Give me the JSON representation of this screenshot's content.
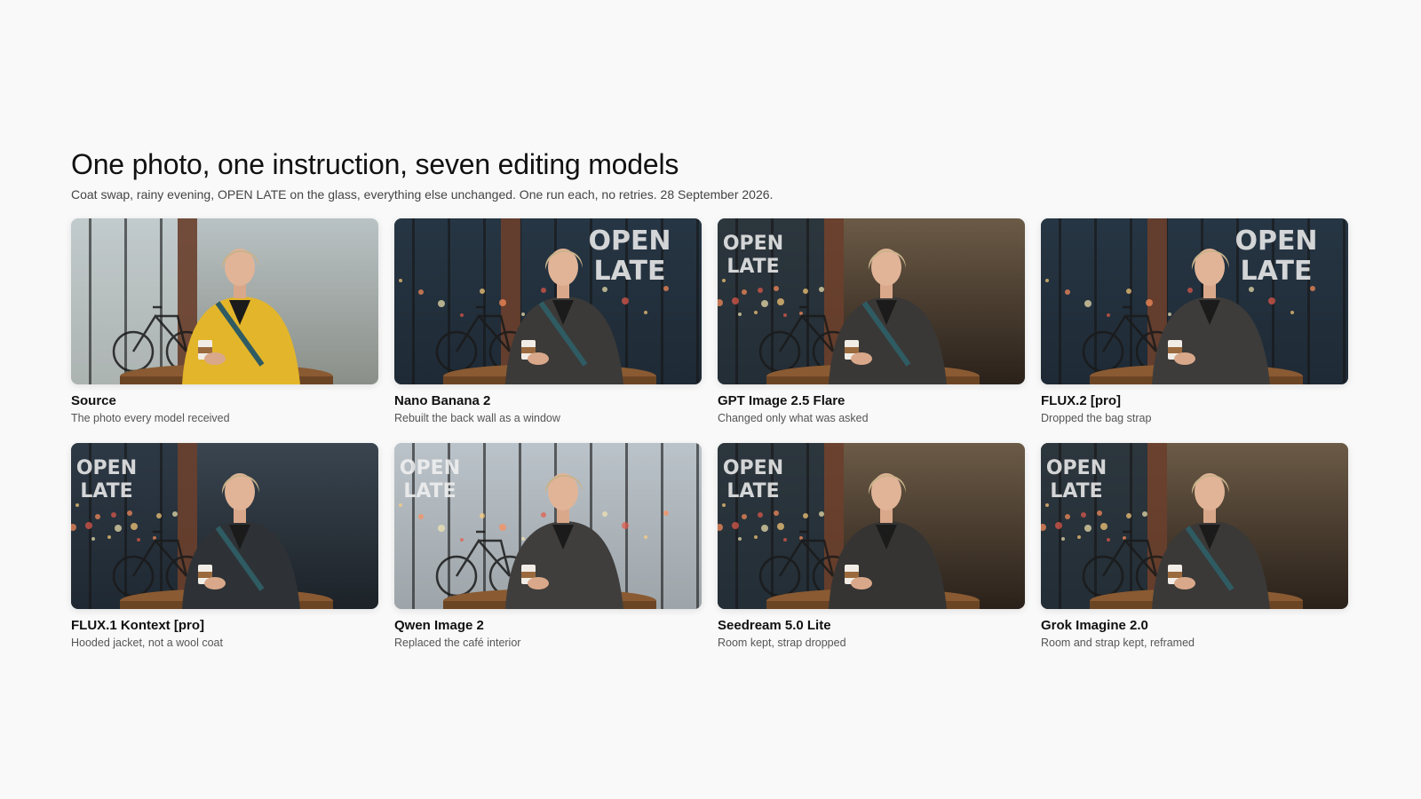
{
  "header": {
    "title": "One photo, one instruction, seven editing models",
    "subtitle": "Coat swap, rainy evening, OPEN LATE on the glass, everything else unchanged. One run each, no retries. 28 September 2026."
  },
  "cards": [
    {
      "name": "Source",
      "desc": "The photo every model received",
      "scene": "day",
      "coat": "#e3b52a",
      "sign": "",
      "strap": true
    },
    {
      "name": "Nano Banana 2",
      "desc": "Rebuilt the back wall as a window",
      "scene": "window",
      "coat": "#3b3a38",
      "sign": "OPEN LATE",
      "strap": true
    },
    {
      "name": "GPT Image 2.5 Flare",
      "desc": "Changed only what was asked",
      "scene": "wall",
      "coat": "#3a3836",
      "sign": "OPEN LATE",
      "strap": true
    },
    {
      "name": "FLUX.2 [pro]",
      "desc": "Dropped the bag strap",
      "scene": "window",
      "coat": "#3d3c3a",
      "sign": "OPEN LATE",
      "strap": false
    },
    {
      "name": "FLUX.1 Kontext [pro]",
      "desc": "Hooded jacket, not a wool coat",
      "scene": "dark",
      "coat": "#2e3236",
      "sign": "OPEN LATE",
      "strap": true
    },
    {
      "name": "Qwen Image 2",
      "desc": "Replaced the café interior",
      "scene": "street",
      "coat": "#3f3e3c",
      "sign": "OPEN LATE",
      "strap": false
    },
    {
      "name": "Seedream 5.0 Lite",
      "desc": "Room kept, strap dropped",
      "scene": "wall",
      "coat": "#353433",
      "sign": "OPEN LATE",
      "strap": false
    },
    {
      "name": "Grok Imagine 2.0",
      "desc": "Room and strap kept, reframed",
      "scene": "wall",
      "coat": "#3a3937",
      "sign": "OPEN LATE",
      "strap": true
    }
  ]
}
